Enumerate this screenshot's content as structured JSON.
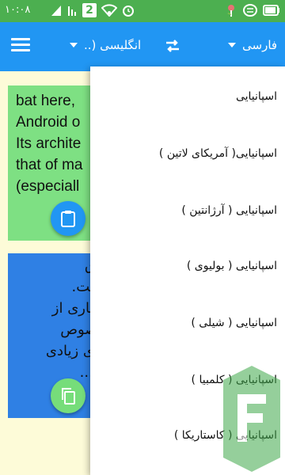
{
  "status_bar": {
    "time": "۱۰:۰۸",
    "sim_number": "2",
    "icons": [
      "signal-icon",
      "sim-icon",
      "wifi-icon",
      "alarm-icon",
      "flower-icon",
      "data-usage-icon",
      "battery-icon"
    ]
  },
  "toolbar": {
    "source_language": "انگلیسی (..",
    "target_language": "فارسی",
    "accent_color": "#2196f3"
  },
  "input_card": {
    "lines": [
      "bat here,",
      "Android o",
      "Its archite",
      "that of ma",
      "(especiall"
    ],
    "color": "#7ee083"
  },
  "output_card": {
    "lines": [
      "ادق",
      "است.",
      "سیاری از",
      "خصوص",
      "های زیادی",
      "با ..."
    ],
    "color": "#2f80e4"
  },
  "dropdown": {
    "items": [
      "اسپانیایی",
      "اسپانیایی( آمریکای لاتین )",
      "اسپانیایی ( آرژانتین )",
      "اسپانیایی ( بولیوی )",
      "اسپانیایی ( شیلی )",
      "اسپانیایی ( کلمبیا )",
      "اسپانیایی ( کاستاریکا )"
    ]
  }
}
